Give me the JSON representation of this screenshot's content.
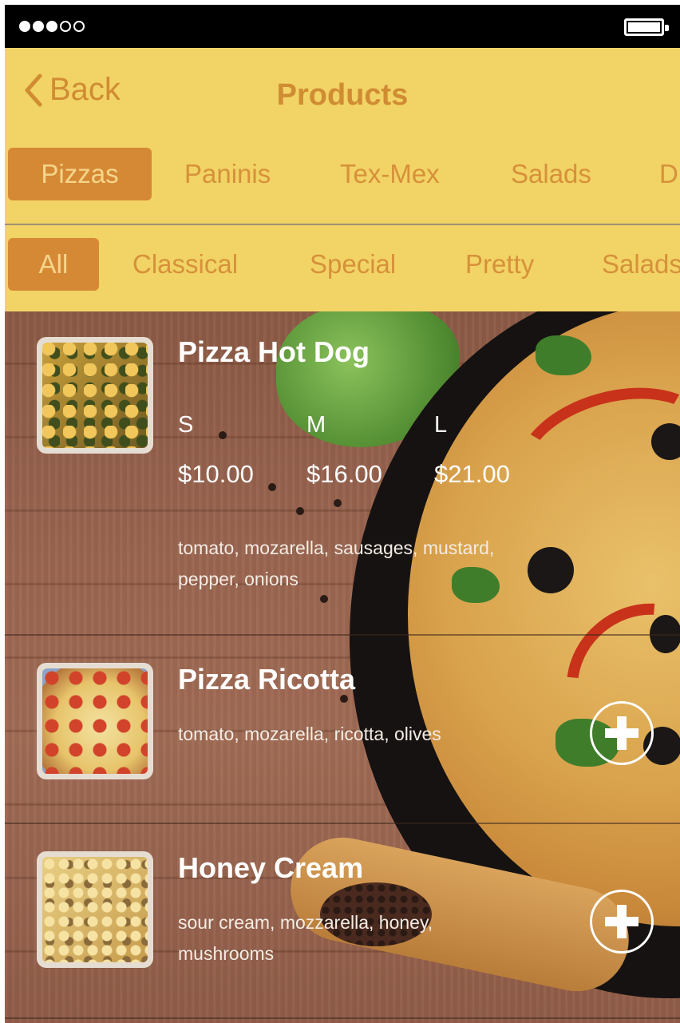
{
  "status_bar": {
    "signal_bars_filled": 3,
    "signal_bars_total": 5,
    "battery_icon": "battery-full-icon"
  },
  "nav": {
    "back_label": "Back",
    "title": "Products"
  },
  "category_tabs": [
    {
      "label": "Pizzas",
      "active": true
    },
    {
      "label": "Paninis",
      "active": false
    },
    {
      "label": "Tex-Mex",
      "active": false
    },
    {
      "label": "Salads",
      "active": false
    },
    {
      "label": "D",
      "active": false
    }
  ],
  "filter_tabs": [
    {
      "label": "All",
      "active": true
    },
    {
      "label": "Classical",
      "active": false
    },
    {
      "label": "Special",
      "active": false
    },
    {
      "label": "Pretty",
      "active": false
    },
    {
      "label": "Salads",
      "active": false
    }
  ],
  "products": [
    {
      "name": "Pizza Hot Dog",
      "sizes": [
        {
          "size": "S",
          "price": "$10.00"
        },
        {
          "size": "M",
          "price": "$16.00"
        },
        {
          "size": "L",
          "price": "$21.00"
        }
      ],
      "ingredients_line1": "tomato, mozarella, sausages, mustard,",
      "ingredients_line2": "pepper, onions"
    },
    {
      "name": "Pizza Ricotta",
      "ingredients_line1": "tomato, mozarella, ricotta, olives"
    },
    {
      "name": "Honey Cream",
      "ingredients_line1": "sour cream, mozzarella, honey,",
      "ingredients_line2": "mushrooms"
    }
  ],
  "colors": {
    "header_bg": "#f2d366",
    "accent": "#d08c33",
    "active_tab_bg": "#d58935"
  }
}
